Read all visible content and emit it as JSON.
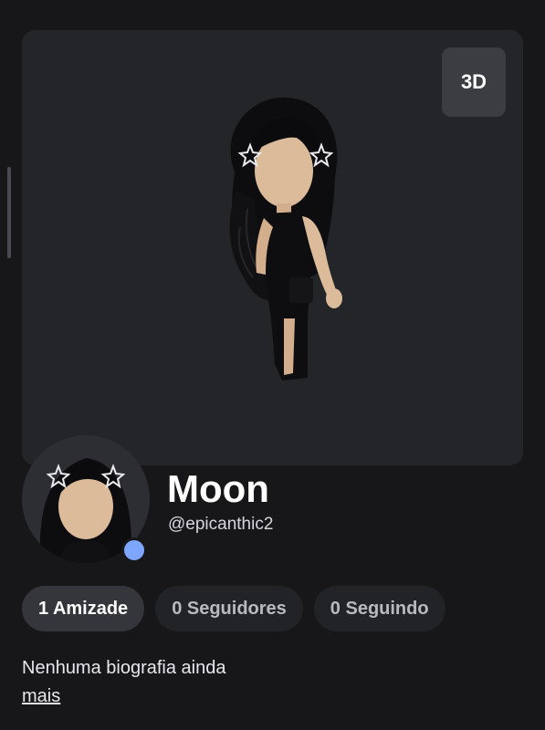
{
  "viewer": {
    "mode_button_label": "3D"
  },
  "profile": {
    "display_name": "Moon",
    "username": "@epicanthic2",
    "status_color": "#7fa6ff"
  },
  "stats": [
    {
      "label": "1 Amizade",
      "active": true
    },
    {
      "label": "0 Seguidores",
      "active": false
    },
    {
      "label": "0 Seguindo",
      "active": false
    }
  ],
  "bio": {
    "text": "Nenhuma biografia ainda",
    "more_label": "mais"
  },
  "icons": {
    "hair_accessory": "star-hairclip-icon"
  }
}
